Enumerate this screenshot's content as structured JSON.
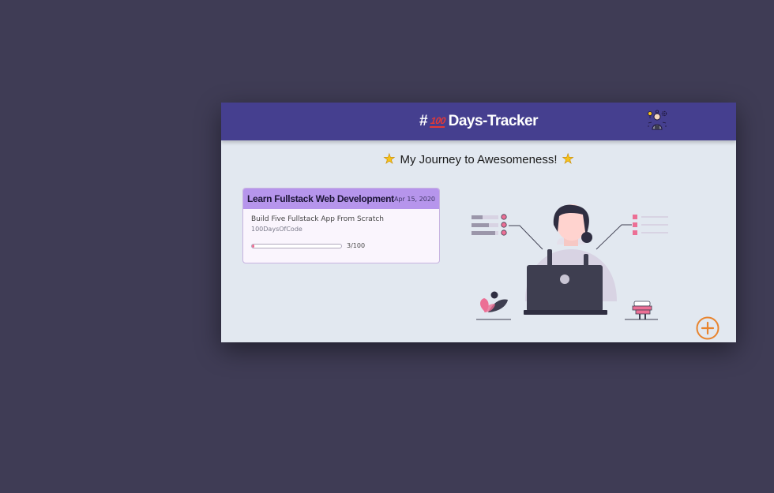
{
  "header": {
    "hash": "#",
    "hundred_badge": "100",
    "title": "Days-Tracker",
    "profile_icon": "person-gears-icon"
  },
  "subtitle": {
    "text": "My Journey to Awesomeness!",
    "icon": "star-icon"
  },
  "goals": [
    {
      "title": "Learn Fullstack Web Development",
      "date": "Apr 15, 2020",
      "description": "Build Five Fullstack App From Scratch",
      "tag": "100DaysOfCode",
      "progress": {
        "current": 3,
        "total": 100,
        "label": "3/100"
      }
    }
  ],
  "add_button": {
    "icon": "plus-circle-icon"
  },
  "colors": {
    "background": "#3f3c55",
    "header": "#453f8f",
    "card_header": "#b695ec",
    "accent_pink": "#ec6f95",
    "add_button": "#e8842e"
  }
}
